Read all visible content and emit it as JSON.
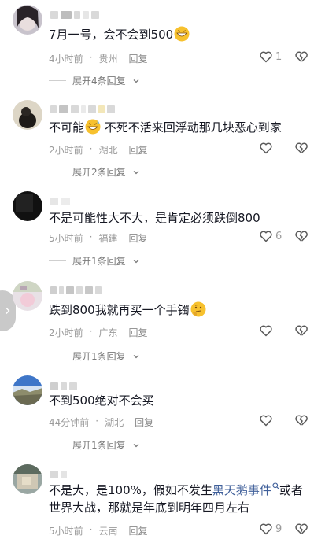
{
  "comments": [
    {
      "text": "7月一号，会不会到500",
      "time": "4小时前",
      "location": "贵州",
      "reply": "回复",
      "likes": "1",
      "expand": "展开4条回复"
    },
    {
      "text": "不可能",
      "text2": " 不死不活来回浮动那几块恶心到家",
      "time": "2小时前",
      "location": "湖北",
      "reply": "回复",
      "likes": "",
      "expand": "展开2条回复"
    },
    {
      "text": "不是可能性大不大，是肯定必须跌倒800",
      "time": "5小时前",
      "location": "福建",
      "reply": "回复",
      "likes": "6",
      "expand": "展开1条回复"
    },
    {
      "text": "跌到800我就再买一个手镯",
      "time": "2小时前",
      "location": "广东",
      "reply": "回复",
      "likes": "",
      "expand": "展开1条回复"
    },
    {
      "text": "不到500绝对不会买",
      "time": "44分钟前",
      "location": "湖北",
      "reply": "回复",
      "likes": "",
      "expand": "展开1条回复"
    },
    {
      "text": "不是大，是100%，假如不发生",
      "link": "黑天鹅事件",
      "text2": "或者世界大战，那就是年底到明年四月左右",
      "time": "5小时前",
      "location": "云南",
      "reply": "回复",
      "likes": "9"
    }
  ],
  "icons": {
    "like": "heart-outline-icon",
    "dislike": "broken-heart-icon",
    "expand": "chevron-down-icon",
    "search": "search-icon",
    "side_tab": "chevron-right-icon"
  },
  "colors": {
    "text": "#161823",
    "meta": "#9b9b9b",
    "link": "#3f5f9a",
    "emoji": "#f7c12e"
  }
}
